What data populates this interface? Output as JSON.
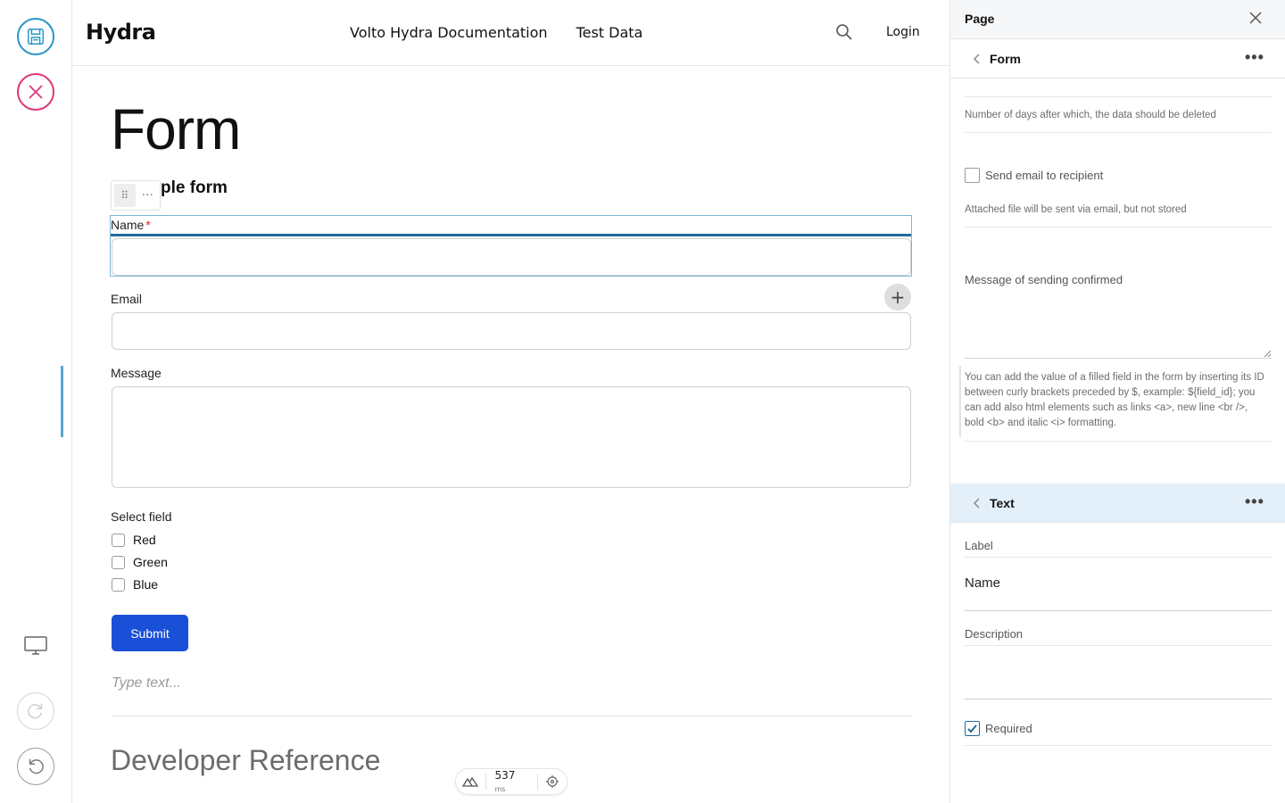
{
  "toolbar": {
    "save_icon": "save-icon",
    "cancel_icon": "close-circle-icon",
    "display_icon": "monitor-icon",
    "redo_icon": "redo-icon",
    "undo_icon": "undo-icon",
    "colors": {
      "save": "#2996c6",
      "cancel": "#e0357a"
    }
  },
  "header": {
    "logo": "Hydra",
    "nav": [
      "Volto Hydra Documentation",
      "Test Data"
    ],
    "login": "Login"
  },
  "main": {
    "page_title": "Form",
    "form_title": "ple form",
    "fields": {
      "name_label": "Name",
      "required_mark": "*",
      "email_label": "Email",
      "message_label": "Message",
      "select_label": "Select field",
      "options": [
        "Red",
        "Green",
        "Blue"
      ]
    },
    "submit": "Submit",
    "type_placeholder": "Type text...",
    "dev_reference": "Developer Reference",
    "perf_ms": "537",
    "perf_unit": "ms"
  },
  "sidebar": {
    "title": "Page",
    "form_section": "Form",
    "days_help": "Number of days after which, the data should be deleted",
    "send_email": "Send email to recipient",
    "attached_help": "Attached file will be sent via email, but not stored",
    "message_confirm": "Message of sending confirmed",
    "message_help": "You can add the value of a filled field in the form by inserting its ID between curly brackets preceded by $, example: ${field_id}; you can add also html elements such as links <a>, new line <br />, bold <b> and italic <i> formatting.",
    "text_section": "Text",
    "label_label": "Label",
    "label_value": "Name",
    "description_label": "Description",
    "required_label": "Required",
    "required_checked": true,
    "accent": "#1f6c99"
  }
}
